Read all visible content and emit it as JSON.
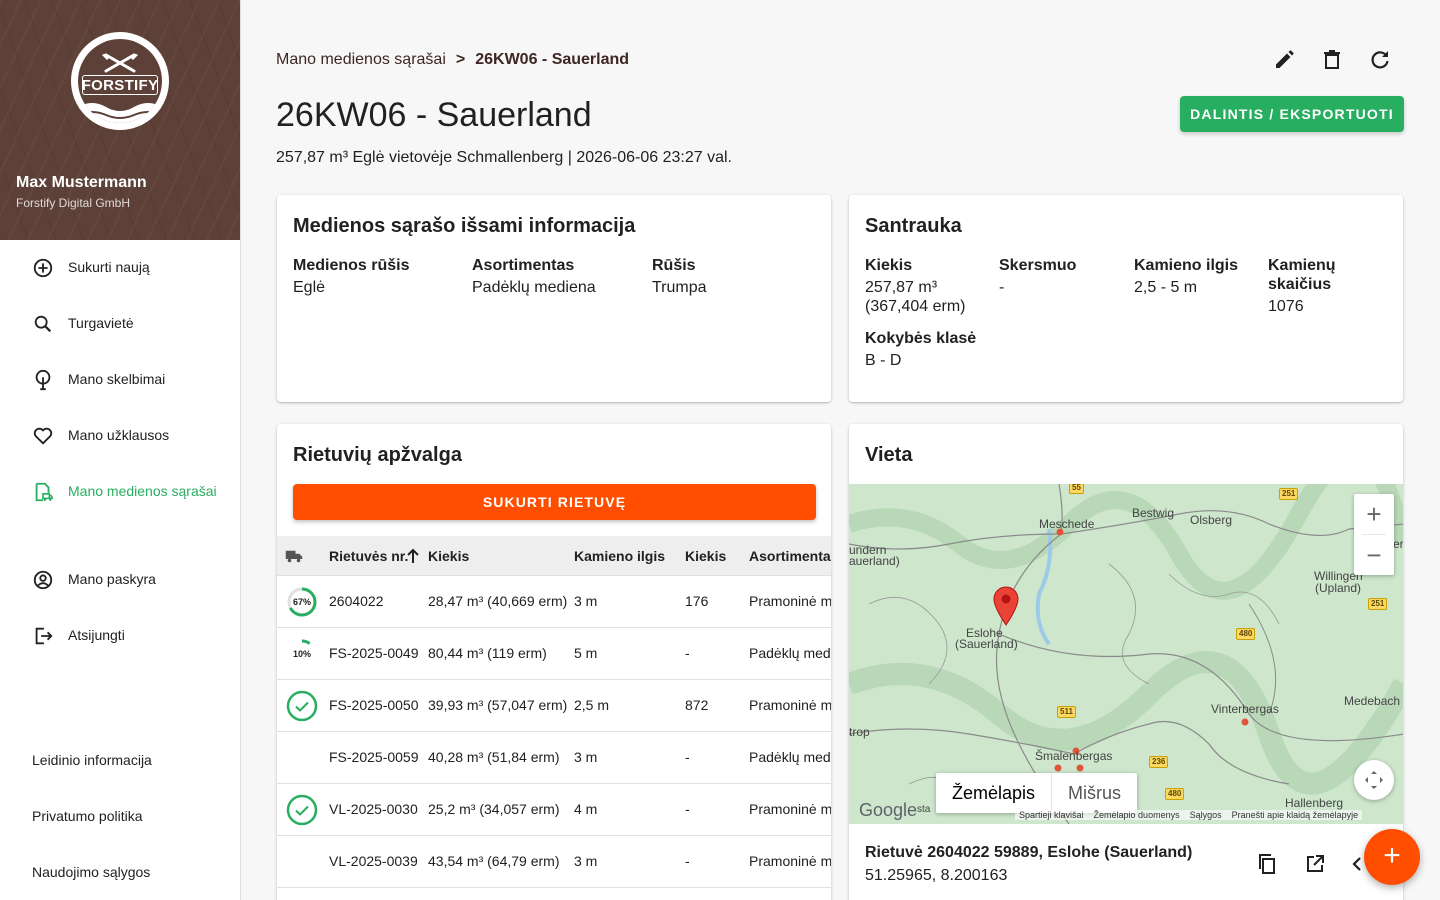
{
  "sidebar": {
    "logo_text": "FORSTIFY",
    "user_name": "Max Mustermann",
    "user_company": "Forstify Digital GmbH",
    "nav": [
      {
        "label": "Sukurti naują",
        "icon": "add-circle-icon"
      },
      {
        "label": "Turgavietė",
        "icon": "search-icon"
      },
      {
        "label": "Mano skelbimai",
        "icon": "tree-icon"
      },
      {
        "label": "Mano užklausos",
        "icon": "heart-icon"
      },
      {
        "label": "Mano medienos sąrašai",
        "icon": "document-truck-icon",
        "active": true
      },
      {
        "label": "Mano paskyra",
        "icon": "account-circle-icon"
      },
      {
        "label": "Atsijungti",
        "icon": "logout-icon"
      }
    ],
    "footer_links": [
      "Leidinio informacija",
      "Privatumo politika",
      "Naudojimo sąlygos"
    ],
    "active_color": "#27ae60",
    "header_color": "#5d4037"
  },
  "header": {
    "breadcrumb_parent": "Mano medienos sąrašai",
    "breadcrumb_sep": ">",
    "breadcrumb_current": "26KW06 - Sauerland",
    "title": "26KW06 - Sauerland",
    "subtitle": "257,87 m³ Eglė vietovėje Schmallenberg | 2026-06-06 23:27 val.",
    "share_button": "DALINTIS / EKSPORTUOTI",
    "icons": [
      "edit-icon",
      "delete-icon",
      "refresh-icon"
    ]
  },
  "details": {
    "title": "Medienos sąrašo išsami informacija",
    "fields": [
      {
        "label": "Medienos rūšis",
        "value": "Eglė"
      },
      {
        "label": "Asortimentas",
        "value": "Padėklų mediena"
      },
      {
        "label": "Rūšis",
        "value": "Trumpa"
      }
    ]
  },
  "summary": {
    "title": "Santrauka",
    "kiekis_label": "Kiekis",
    "kiekis_value_1": "257,87 m³",
    "kiekis_value_2": "(367,404 erm)",
    "skersmuo_label": "Skersmuo",
    "skersmuo_value": "-",
    "ilgis_label": "Kamieno ilgis",
    "ilgis_value": "2,5 - 5 m",
    "skaicius_label_1": "Kamienų",
    "skaicius_label_2": "skaičius",
    "skaicius_value": "1076",
    "klase_label": "Kokybės klasė",
    "klase_value": "B - D"
  },
  "piles": {
    "title": "Rietuvių apžvalga",
    "create_button": "SUKURTI RIETUVĘ",
    "columns": [
      "Rietuvės nr.",
      "Kiekis",
      "Kamieno ilgis",
      "Kiekis",
      "Asortimentas"
    ],
    "rows": [
      {
        "status": "progress",
        "progress": 67,
        "progress_label": "67%",
        "nr": "2604022",
        "kiekis": "28,47 m³ (40,669 erm)",
        "ilgis": "3 m",
        "kiekis2": "176",
        "asortimentas": "Pramoninė m"
      },
      {
        "status": "progress",
        "progress": 10,
        "progress_label": "10%",
        "nr": "FS-2025-0049",
        "kiekis": "80,44 m³ (119 erm)",
        "ilgis": "5 m",
        "kiekis2": "-",
        "asortimentas": "Padėklų med"
      },
      {
        "status": "done",
        "nr": "FS-2025-0050",
        "kiekis": "39,93 m³ (57,047 erm)",
        "ilgis": "2,5 m",
        "kiekis2": "872",
        "asortimentas": "Pramoninė m"
      },
      {
        "status": "none",
        "nr": "FS-2025-0059",
        "kiekis": "40,28 m³ (51,84 erm)",
        "ilgis": "3 m",
        "kiekis2": "-",
        "asortimentas": "Padėklų med"
      },
      {
        "status": "done",
        "nr": "VL-2025-0030",
        "kiekis": "25,2 m³ (34,057 erm)",
        "ilgis": "4 m",
        "kiekis2": "-",
        "asortimentas": "Pramoninė m"
      },
      {
        "status": "none",
        "nr": "VL-2025-0039",
        "kiekis": "43,54 m³ (64,79 erm)",
        "ilgis": "3 m",
        "kiekis2": "-",
        "asortimentas": "Pramoninė m"
      }
    ]
  },
  "location": {
    "title": "Vieta",
    "map_type_map": "Žemėlapis",
    "map_type_satellite": "Mišrus",
    "map_places": [
      "Meschede",
      "Bestwig",
      "Olsberg",
      "Eslohe",
      "(Sauerland)",
      "Willingen",
      "(Upland)",
      "Vinterbergas",
      "Medebach",
      "Šmalenbergas",
      "Hallenberg",
      "undern",
      "auerland)",
      "trop",
      "er"
    ],
    "road_numbers": [
      "55",
      "251",
      "251",
      "480",
      "511",
      "236",
      "480"
    ],
    "google": "Google",
    "google_suffix": "sta",
    "map_footer": [
      "Spartieji klavišai",
      "Žemėlapio duomenys",
      "Sąlygos",
      "Pranešti apie klaidą žemėlapyje"
    ],
    "pile_title": "Rietuvė 2604022 59889, Eslohe (Sauerland)",
    "pile_coords": "51.25965, 8.200163",
    "marker_color": "#ea4335"
  },
  "fab_label": "+"
}
